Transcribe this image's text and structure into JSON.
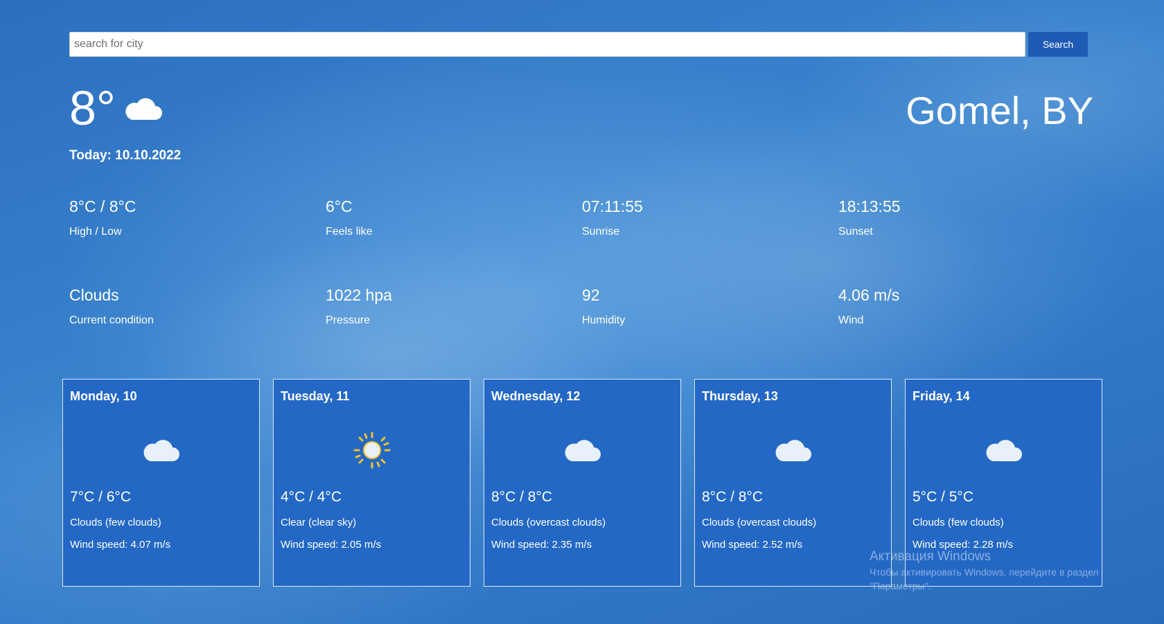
{
  "search": {
    "placeholder": "search for city",
    "value": "",
    "button_label": "Search"
  },
  "current": {
    "temperature": "8°",
    "icon": "cloud-icon",
    "city": "Gomel, BY",
    "today": "Today: 10.10.2022"
  },
  "stats": [
    {
      "value": "8°C / 8°C",
      "label": "High / Low"
    },
    {
      "value": "6°C",
      "label": "Feels like"
    },
    {
      "value": "07:11:55",
      "label": "Sunrise"
    },
    {
      "value": "18:13:55",
      "label": "Sunset"
    },
    {
      "value": "Clouds",
      "label": "Current condition"
    },
    {
      "value": "1022 hpa",
      "label": "Pressure"
    },
    {
      "value": "92",
      "label": "Humidity"
    },
    {
      "value": "4.06 m/s",
      "label": "Wind"
    }
  ],
  "forecast": [
    {
      "day": "Monday, 10",
      "icon": "cloud-icon",
      "temp": "7°C / 6°C",
      "desc": "Clouds (few clouds)",
      "wind": "Wind speed: 4.07 m/s"
    },
    {
      "day": "Tuesday, 11",
      "icon": "sun-icon",
      "temp": "4°C / 4°C",
      "desc": "Clear (clear sky)",
      "wind": "Wind speed: 2.05 m/s"
    },
    {
      "day": "Wednesday, 12",
      "icon": "cloud-icon",
      "temp": "8°C / 8°C",
      "desc": "Clouds (overcast clouds)",
      "wind": "Wind speed: 2.35 m/s"
    },
    {
      "day": "Thursday, 13",
      "icon": "cloud-icon",
      "temp": "8°C / 8°C",
      "desc": "Clouds (overcast clouds)",
      "wind": "Wind speed: 2.52 m/s"
    },
    {
      "day": "Friday, 14",
      "icon": "cloud-icon",
      "temp": "5°C / 5°C",
      "desc": "Clouds (few clouds)",
      "wind": "Wind speed: 2.28 m/s"
    }
  ],
  "watermark": {
    "title": "Активация Windows",
    "text": "Чтобы активировать Windows, перейдите в раздел \"Параметры\"."
  },
  "colors": {
    "button": "#1e5bb6",
    "card_background": "#2368c5",
    "sun": "#f2c230"
  }
}
